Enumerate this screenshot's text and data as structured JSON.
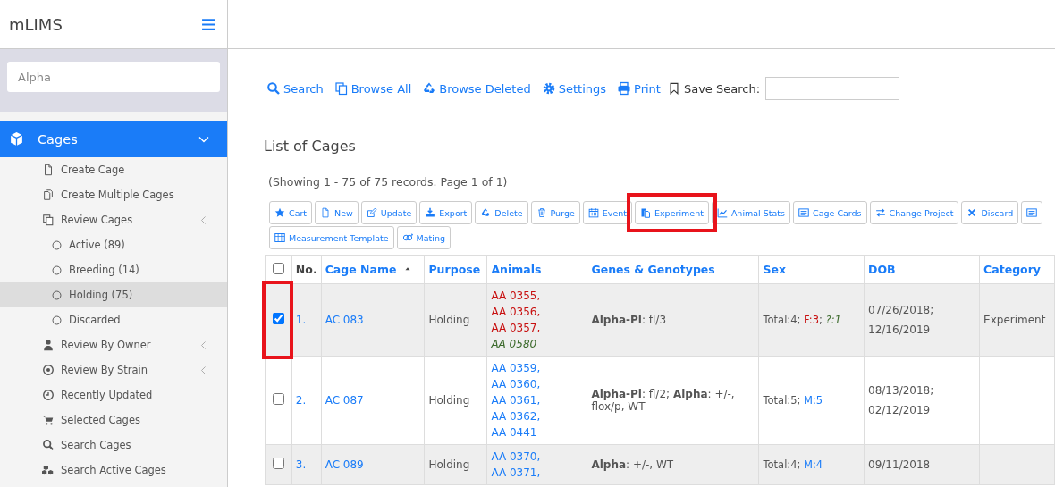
{
  "header": {
    "title": "mLIMS"
  },
  "sidebar": {
    "search": {
      "value": "Alpha"
    },
    "items": [
      {
        "label": "Cages",
        "expanded": true,
        "selected": true,
        "children": [
          {
            "label": "Create Cage",
            "submenu": false
          },
          {
            "label": "Create Multiple Cages",
            "submenu": false
          },
          {
            "label": "Review Cages",
            "submenu": true,
            "children": [
              {
                "label": "Active (89)",
                "selected": false
              },
              {
                "label": "Breeding (14)",
                "selected": false
              },
              {
                "label": "Holding (75)",
                "selected": true
              },
              {
                "label": "Discarded",
                "selected": false
              }
            ]
          },
          {
            "label": "Review By Owner",
            "submenu": true
          },
          {
            "label": "Review By Strain",
            "submenu": true
          },
          {
            "label": "Recently Updated",
            "submenu": false
          },
          {
            "label": "Selected Cages",
            "submenu": false
          },
          {
            "label": "Search Cages",
            "submenu": false
          },
          {
            "label": "Search Active Cages",
            "submenu": false
          }
        ]
      }
    ]
  },
  "top_links": [
    "Search",
    "Browse All",
    "Browse Deleted",
    "Settings",
    "Print"
  ],
  "save_search": {
    "label": "Save Search:"
  },
  "heading": "List of Cages",
  "summary": "(Showing 1 - 75 of 75 records. Page 1 of 1)",
  "actions": [
    {
      "label": "Cart",
      "highlighted": false
    },
    {
      "label": "New",
      "highlighted": false
    },
    {
      "label": "Update",
      "highlighted": false
    },
    {
      "label": "Export",
      "highlighted": false
    },
    {
      "label": "Delete",
      "highlighted": false
    },
    {
      "label": "Purge",
      "highlighted": false
    },
    {
      "label": "Event",
      "highlighted": false
    },
    {
      "label": "Experiment",
      "highlighted": true
    },
    {
      "label": "Animal Stats",
      "highlighted": false
    },
    {
      "label": "Cage Cards",
      "highlighted": false
    },
    {
      "label": "Change Project",
      "highlighted": false
    },
    {
      "label": "Discard",
      "highlighted": false
    },
    {
      "highlighted": false
    },
    {
      "label": "Measurement Template",
      "highlighted": false
    },
    {
      "label": "Mating",
      "highlighted": false
    }
  ],
  "table": {
    "select_all": false,
    "columns": [
      {
        "label": "No.",
        "kind": "plain",
        "sorted": false
      },
      {
        "label": "Cage Name",
        "kind": "link",
        "sorted": true
      },
      {
        "label": "Purpose",
        "kind": "link",
        "sorted": false
      },
      {
        "label": "Animals",
        "kind": "link",
        "sorted": false
      },
      {
        "label": "Genes & Genotypes",
        "kind": "link",
        "sorted": false
      },
      {
        "label": "Sex",
        "kind": "link",
        "sorted": false
      },
      {
        "label": "DOB",
        "kind": "link",
        "sorted": false
      },
      {
        "label": "Category",
        "kind": "link",
        "sorted": false
      }
    ],
    "rows": [
      {
        "checked": true,
        "highlighted": true,
        "no": "1.",
        "cage": "AC 083",
        "purpose": "Holding",
        "animals": [
          {
            "text": "AA 0355,",
            "kind": "female"
          },
          {
            "text": "AA 0356,",
            "kind": "female"
          },
          {
            "text": "AA 0357,",
            "kind": "female"
          },
          {
            "text": "AA 0580",
            "kind": "unknown"
          }
        ],
        "genes": "**Alpha-Pl**: fl/3",
        "sex": [
          {
            "text": "Total:4; ",
            "kind": "plain"
          },
          {
            "text": "F:3",
            "kind": "female"
          },
          {
            "text": "; ",
            "kind": "plain"
          },
          {
            "text": "?:1",
            "kind": "unknown"
          }
        ],
        "dob": [
          "07/26/2018;",
          "12/16/2019"
        ],
        "category": "Experiment"
      },
      {
        "checked": false,
        "highlighted": false,
        "no": "2.",
        "cage": "AC 087",
        "purpose": "Holding",
        "animals": [
          {
            "text": "AA 0359,",
            "kind": "male"
          },
          {
            "text": "AA 0360,",
            "kind": "male"
          },
          {
            "text": "AA 0361,",
            "kind": "male"
          },
          {
            "text": "AA 0362,",
            "kind": "male"
          },
          {
            "text": "AA 0441",
            "kind": "male"
          }
        ],
        "genes": "**Alpha-Pl**: fl/2; **Alpha**: +/-, flox/p, WT",
        "sex": [
          {
            "text": "Total:5; ",
            "kind": "plain"
          },
          {
            "text": "M:5",
            "kind": "male"
          }
        ],
        "dob": [
          "08/13/2018;",
          "02/12/2019"
        ]
      },
      {
        "checked": false,
        "highlighted": false,
        "no": "3.",
        "cage": "AC 089",
        "purpose": "Holding",
        "animals": [
          {
            "text": "AA 0370,",
            "kind": "male"
          },
          {
            "text": "AA 0371,",
            "kind": "male"
          }
        ],
        "genes": "**Alpha**: +/-, WT",
        "sex": [
          {
            "text": "Total:4; ",
            "kind": "plain"
          },
          {
            "text": "M:4",
            "kind": "male"
          }
        ],
        "dob": [
          "09/11/2018"
        ]
      }
    ]
  }
}
